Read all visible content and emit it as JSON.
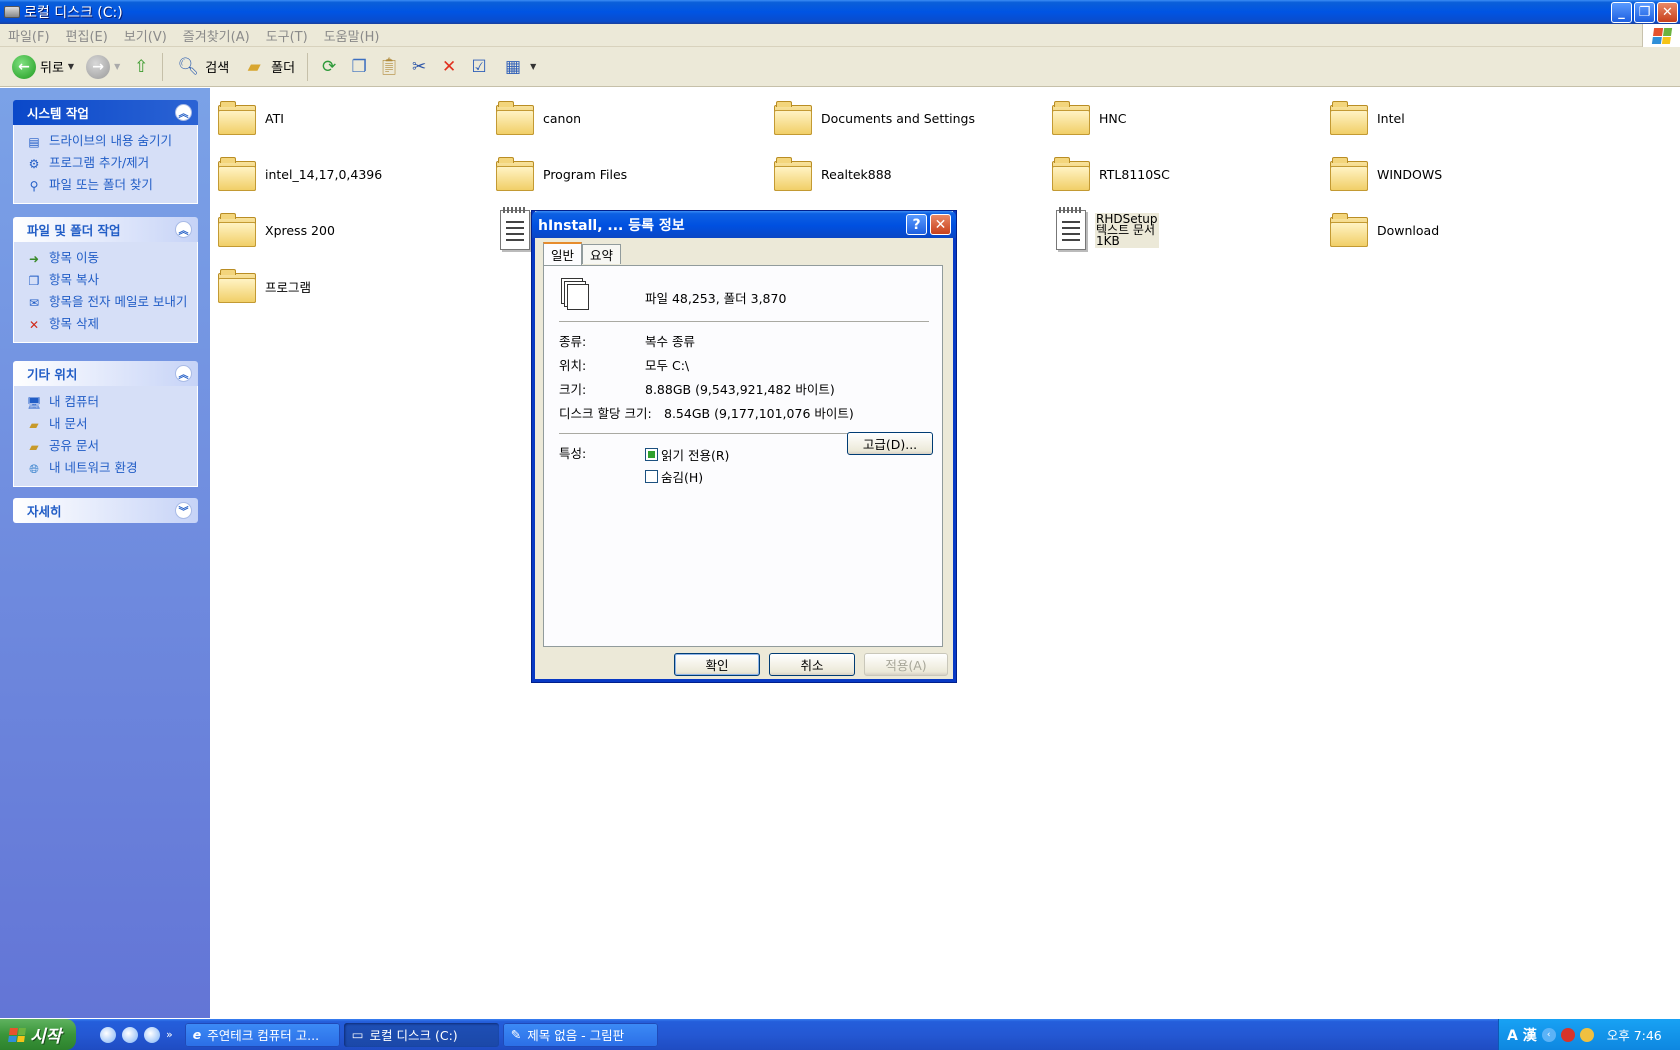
{
  "window": {
    "title": "로컬 디스크 (C:)",
    "controls": [
      "minimize-icon",
      "restore-icon",
      "close-icon"
    ]
  },
  "menu": [
    "파일(F)",
    "편집(E)",
    "보기(V)",
    "즐겨찾기(A)",
    "도구(T)",
    "도움말(H)"
  ],
  "toolbar": {
    "back_label": "뒤로",
    "search_label": "검색",
    "folders_label": "폴더"
  },
  "sidebar": {
    "system_tasks": {
      "title": "시스템 작업",
      "items": [
        "드라이브의 내용 숨기기",
        "프로그램 추가/제거",
        "파일 또는 폴더 찾기"
      ]
    },
    "file_tasks": {
      "title": "파일 및 폴더 작업",
      "items": [
        "항목 이동",
        "항목 복사",
        "항목을 전자 메일로 보내기",
        "항목 삭제"
      ]
    },
    "other_places": {
      "title": "기타 위치",
      "items": [
        "내 컴퓨터",
        "내 문서",
        "공유 문서",
        "내 네트워크 환경"
      ]
    },
    "details": {
      "title": "자세히"
    }
  },
  "files": [
    {
      "name": "ATI",
      "type": "folder"
    },
    {
      "name": "canon",
      "type": "folder"
    },
    {
      "name": "Documents and Settings",
      "type": "folder"
    },
    {
      "name": "HNC",
      "type": "folder"
    },
    {
      "name": "Intel",
      "type": "folder"
    },
    {
      "name": "intel_14,17,0,4396",
      "type": "folder"
    },
    {
      "name": "Program Files",
      "type": "folder"
    },
    {
      "name": "Realtek888",
      "type": "folder"
    },
    {
      "name": "RTL8110SC",
      "type": "folder"
    },
    {
      "name": "WINDOWS",
      "type": "folder"
    },
    {
      "name": "Xpress 200",
      "type": "folder"
    },
    {
      "name": "RHDSetup",
      "type": "document",
      "subtitle": "텍스트 문서",
      "size": "1KB"
    },
    {
      "name": "Download",
      "type": "folder"
    },
    {
      "name": "프로그램",
      "type": "folder"
    }
  ],
  "dialog": {
    "title": "hInstall, ... 등록 정보",
    "tabs": [
      "일반",
      "요약"
    ],
    "summary": "파일 48,253, 폴더 3,870",
    "type_label": "종류:",
    "type_value": "복수 종류",
    "location_label": "위치:",
    "location_value": "모두 C:\\",
    "size_label": "크기:",
    "size_value": "8.88GB (9,543,921,482 바이트)",
    "disk_label": "디스크 할당 크기:",
    "disk_value": "8.54GB (9,177,101,076 바이트)",
    "attributes_label": "특성:",
    "readonly_label": "읽기 전용(R)",
    "readonly_state": "mixed",
    "hidden_label": "숨김(H)",
    "hidden_state": "unchecked",
    "advanced_label": "고급(D)...",
    "ok_label": "확인",
    "cancel_label": "취소",
    "apply_label": "적용(A)"
  },
  "taskbar": {
    "start_label": "시작",
    "tasks": [
      "주연테크 컴퓨터 고...",
      "로컬 디스크 (C:)",
      "제목 없음 - 그림판"
    ],
    "active_task_index": 1,
    "tray_time": "오후 7:46",
    "ime_label": "A 漢"
  }
}
